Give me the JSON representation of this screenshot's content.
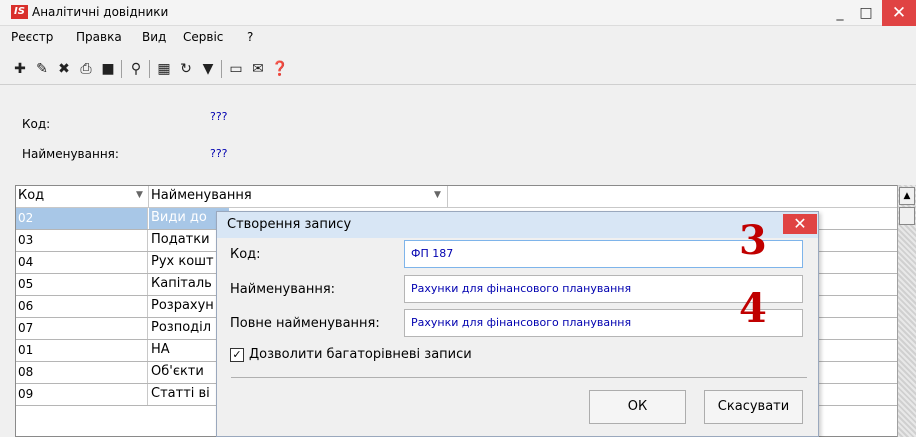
{
  "window": {
    "title": "Аналітичні довідники",
    "logo": "IS",
    "min": "_",
    "max": "□",
    "close": "✕"
  },
  "menu": [
    "Реєстр",
    "Правка",
    "Вид",
    "Сервіс",
    "?"
  ],
  "toolbar": {
    "icons": [
      "new-record-icon",
      "copy-record-icon",
      "delete-record-icon",
      "print-icon",
      "export-icon",
      "search-icon",
      "grid-icon",
      "refresh-icon",
      "filter-icon",
      "form-icon",
      "mail-icon",
      "help-icon"
    ],
    "glyphs": [
      "✚",
      "✎",
      "✖",
      "⎙",
      "■",
      "⚲",
      "▦",
      "↻",
      "▼",
      "▭",
      "✉",
      "❓"
    ]
  },
  "header_fields": {
    "code_label": "Код:",
    "code_value": "???",
    "name_label": "Найменування:",
    "name_value": "???"
  },
  "grid": {
    "columns": [
      "Код",
      "Найменування"
    ],
    "rows": [
      {
        "code": "02",
        "name": "Види до"
      },
      {
        "code": "03",
        "name": "Податки"
      },
      {
        "code": "04",
        "name": "Рух кошт"
      },
      {
        "code": "05",
        "name": "Капіталь"
      },
      {
        "code": "06",
        "name": "Розрахун"
      },
      {
        "code": "07",
        "name": "Розподіл"
      },
      {
        "code": "01",
        "name": "НА"
      },
      {
        "code": "08",
        "name": "Об'єкти"
      },
      {
        "code": "09",
        "name": "Статті ві"
      }
    ]
  },
  "dialog": {
    "title": "Створення запису",
    "close": "✕",
    "code_label": "Код:",
    "code_value": "ФП 187",
    "name_label": "Найменування:",
    "name_value": "Рахунки для фінансового планування",
    "fullname_label": "Повне найменування:",
    "fullname_value": "Рахунки для фінансового планування",
    "checkbox_mark": "✓",
    "checkbox_label": "Дозволити багаторівневі записи",
    "ok_label": "ОК",
    "cancel_label": "Скасувати"
  },
  "annotations": {
    "step3": "3",
    "step4": "4",
    "color": "#c00000"
  }
}
